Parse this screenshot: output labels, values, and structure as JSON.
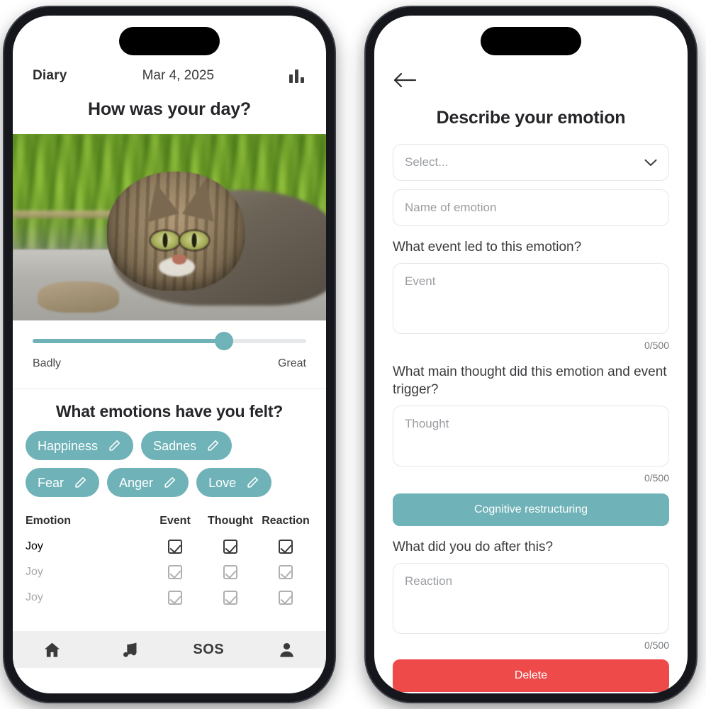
{
  "left_phone": {
    "header": {
      "app_title": "Diary",
      "date": "Mar 4, 2025",
      "chart_icon": "bar-chart-icon"
    },
    "day_question": "How was your day?",
    "photo": {
      "alt": "Tabby cat lying down on concrete with blurred green grass background"
    },
    "mood_slider": {
      "value_percent": 70,
      "min_label": "Badly",
      "max_label": "Great"
    },
    "emotions_title": "What emotions have you felt?",
    "emotion_chips": [
      {
        "label": "Happiness",
        "edit_icon": "pencil-icon"
      },
      {
        "label": "Sadnes",
        "edit_icon": "pencil-icon"
      },
      {
        "label": "Fear",
        "edit_icon": "pencil-icon"
      },
      {
        "label": "Anger",
        "edit_icon": "pencil-icon"
      },
      {
        "label": "Love",
        "edit_icon": "pencil-icon"
      }
    ],
    "table": {
      "headers": {
        "emotion": "Emotion",
        "event": "Event",
        "thought": "Thought",
        "reaction": "Reaction"
      },
      "rows": [
        {
          "emotion": "Joy",
          "event": true,
          "thought": true,
          "reaction": true,
          "dim": false
        },
        {
          "emotion": "Joy",
          "event": true,
          "thought": true,
          "reaction": true,
          "dim": true
        },
        {
          "emotion": "Joy",
          "event": true,
          "thought": true,
          "reaction": true,
          "dim": true
        }
      ]
    },
    "tabbar": [
      {
        "name": "home-icon",
        "label": ""
      },
      {
        "name": "music-note-icon",
        "label": ""
      },
      {
        "name": "sos-label",
        "label": "SOS"
      },
      {
        "name": "person-icon",
        "label": ""
      }
    ]
  },
  "right_phone": {
    "back_icon": "arrow-left-icon",
    "title": "Describe your emotion",
    "emotion_select": {
      "value": "Select...",
      "chevron_icon": "chevron-down-icon"
    },
    "emotion_name": {
      "placeholder": "Name of emotion",
      "value": ""
    },
    "event_section": {
      "label": "What event led to this emotion?",
      "placeholder": "Event",
      "counter": "0/500"
    },
    "thought_section": {
      "label": "What main thought did this emotion and event trigger?",
      "placeholder": "Thought",
      "counter": "0/500"
    },
    "cognitive_button": "Cognitive restructuring",
    "reaction_section": {
      "label": "What did you do after this?",
      "placeholder": "Reaction",
      "counter": "0/500"
    },
    "delete_button": "Delete"
  },
  "colors": {
    "teal": "#6fb2b8",
    "red": "#ef4a4a",
    "frame": "#15171c",
    "text": "#26262a",
    "placeholder": "#9a9da1"
  }
}
